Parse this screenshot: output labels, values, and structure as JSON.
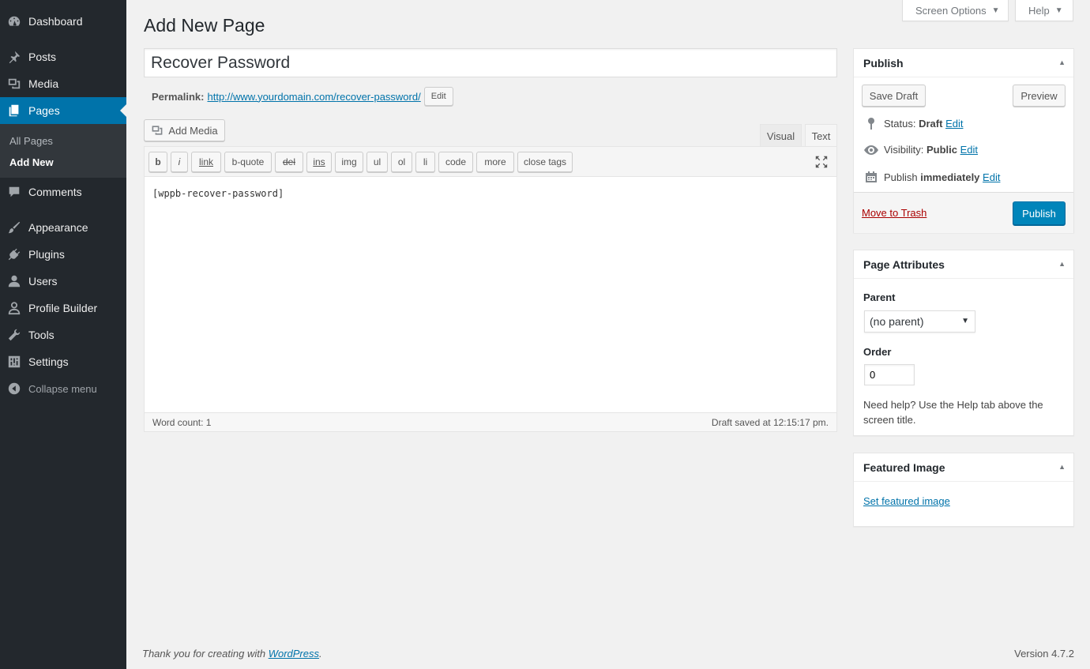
{
  "sidebar": {
    "items": [
      {
        "label": "Dashboard",
        "icon": "dashboard-icon"
      },
      {
        "label": "Posts",
        "icon": "pin-icon"
      },
      {
        "label": "Media",
        "icon": "media-icon"
      },
      {
        "label": "Pages",
        "icon": "pages-icon"
      },
      {
        "label": "Comments",
        "icon": "comments-icon"
      },
      {
        "label": "Appearance",
        "icon": "paintbrush-icon"
      },
      {
        "label": "Plugins",
        "icon": "plugin-icon"
      },
      {
        "label": "Users",
        "icon": "users-icon"
      },
      {
        "label": "Profile Builder",
        "icon": "profile-icon"
      },
      {
        "label": "Tools",
        "icon": "wrench-icon"
      },
      {
        "label": "Settings",
        "icon": "settings-icon"
      },
      {
        "label": "Collapse menu",
        "icon": "collapse-icon"
      }
    ],
    "submenu": [
      {
        "label": "All Pages"
      },
      {
        "label": "Add New"
      }
    ]
  },
  "top": {
    "screen_options": "Screen Options",
    "help": "Help"
  },
  "main": {
    "page_title": "Add New Page",
    "post_title": "Recover Password",
    "permalink_label": "Permalink:",
    "permalink_base": "http://www.yourdomain.com/",
    "permalink_slug": "recover-password",
    "permalink_trail": "/",
    "permalink_edit": "Edit",
    "add_media": "Add Media",
    "tab_visual": "Visual",
    "tab_text": "Text",
    "quicktags": [
      "b",
      "i",
      "link",
      "b-quote",
      "del",
      "ins",
      "img",
      "ul",
      "ol",
      "li",
      "code",
      "more",
      "close tags"
    ],
    "content": "[wppb-recover-password]",
    "word_count": "Word count: 1",
    "draft_saved": "Draft saved at 12:15:17 pm."
  },
  "publish": {
    "title": "Publish",
    "save_draft": "Save Draft",
    "preview": "Preview",
    "status_label": "Status:",
    "status_value": "Draft",
    "visibility_label": "Visibility:",
    "visibility_value": "Public",
    "publish_label": "Publish",
    "publish_value": "immediately",
    "edit": "Edit",
    "move_to_trash": "Move to Trash",
    "publish_button": "Publish"
  },
  "page_attributes": {
    "title": "Page Attributes",
    "parent_label": "Parent",
    "parent_value": "(no parent)",
    "order_label": "Order",
    "order_value": "0",
    "help_text": "Need help? Use the Help tab above the screen title."
  },
  "featured_image": {
    "title": "Featured Image",
    "link": "Set featured image"
  },
  "footer": {
    "thanks_prefix": "Thank you for creating with ",
    "thanks_link": "WordPress",
    "thanks_suffix": ".",
    "version": "Version 4.7.2"
  },
  "colors": {
    "sidebar_bg": "#23282d",
    "accent": "#0073aa",
    "primary_button": "#0085ba",
    "trash": "#a00"
  }
}
